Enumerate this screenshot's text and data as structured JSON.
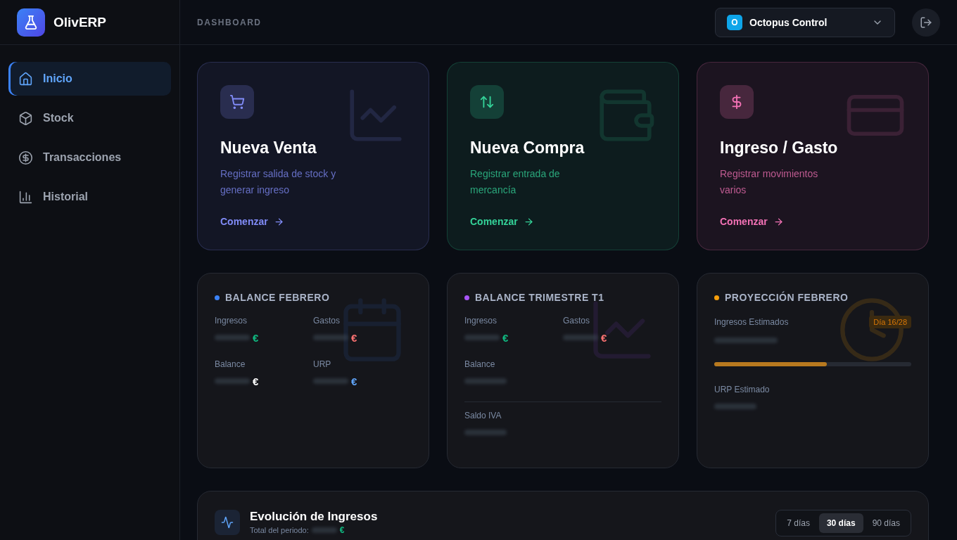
{
  "app": {
    "name": "OlivERP"
  },
  "sidebar": {
    "items": [
      {
        "label": "Inicio",
        "selected": true
      },
      {
        "label": "Stock",
        "selected": false
      },
      {
        "label": "Transacciones",
        "selected": false
      },
      {
        "label": "Historial",
        "selected": false
      }
    ]
  },
  "header": {
    "breadcrumb": "DASHBOARD",
    "company": {
      "badge": "O",
      "name": "Octopus Control"
    }
  },
  "actions": [
    {
      "title": "Nueva Venta",
      "description": "Registrar salida de stock y generar ingreso",
      "link": "Comenzar",
      "color": "#818cf8"
    },
    {
      "title": "Nueva Compra",
      "description": "Registrar entrada de mercancía",
      "link": "Comenzar",
      "color": "#34d399"
    },
    {
      "title": "Ingreso / Gasto",
      "description": "Registrar movimientos varios",
      "link": "Comenzar",
      "color": "#f472b6"
    }
  ],
  "stats": [
    {
      "kind": "balance",
      "title": "BALANCE FEBRERO",
      "color": "#3b82f6",
      "fields": [
        {
          "label": "Ingresos",
          "value": "€",
          "color": "#10b981"
        },
        {
          "label": "Gastos",
          "value": "€",
          "color": "#f87171"
        },
        {
          "label": "Balance",
          "value": "€",
          "color": "#ffffff"
        },
        {
          "label": "URP",
          "value": "€",
          "color": "#60a5fa"
        }
      ]
    },
    {
      "kind": "quarter",
      "title": "BALANCE TRIMESTRE T1",
      "color": "#a855f7",
      "fields": [
        {
          "label": "Ingresos",
          "value": "€",
          "color": "#10b981"
        },
        {
          "label": "Gastos",
          "value": "€",
          "color": "#f87171"
        },
        {
          "label": "Balance"
        }
      ],
      "footer": {
        "label": "Saldo IVA"
      }
    },
    {
      "kind": "projection",
      "title": "PROYECCIÓN FEBRERO",
      "color": "#f59e0b",
      "badge": "Día 16/28",
      "level": 0.57,
      "fields": [
        {
          "label": "Ingresos Estimados"
        },
        {
          "label": "URP Estimado"
        }
      ]
    }
  ],
  "chart": {
    "title": "Evolución de Ingresos",
    "subtitle": "Total del periodo:",
    "total": "€",
    "ranges": [
      {
        "label": "7 días",
        "selected": false
      },
      {
        "label": "30 días",
        "selected": true
      },
      {
        "label": "90 días",
        "selected": false
      }
    ]
  }
}
